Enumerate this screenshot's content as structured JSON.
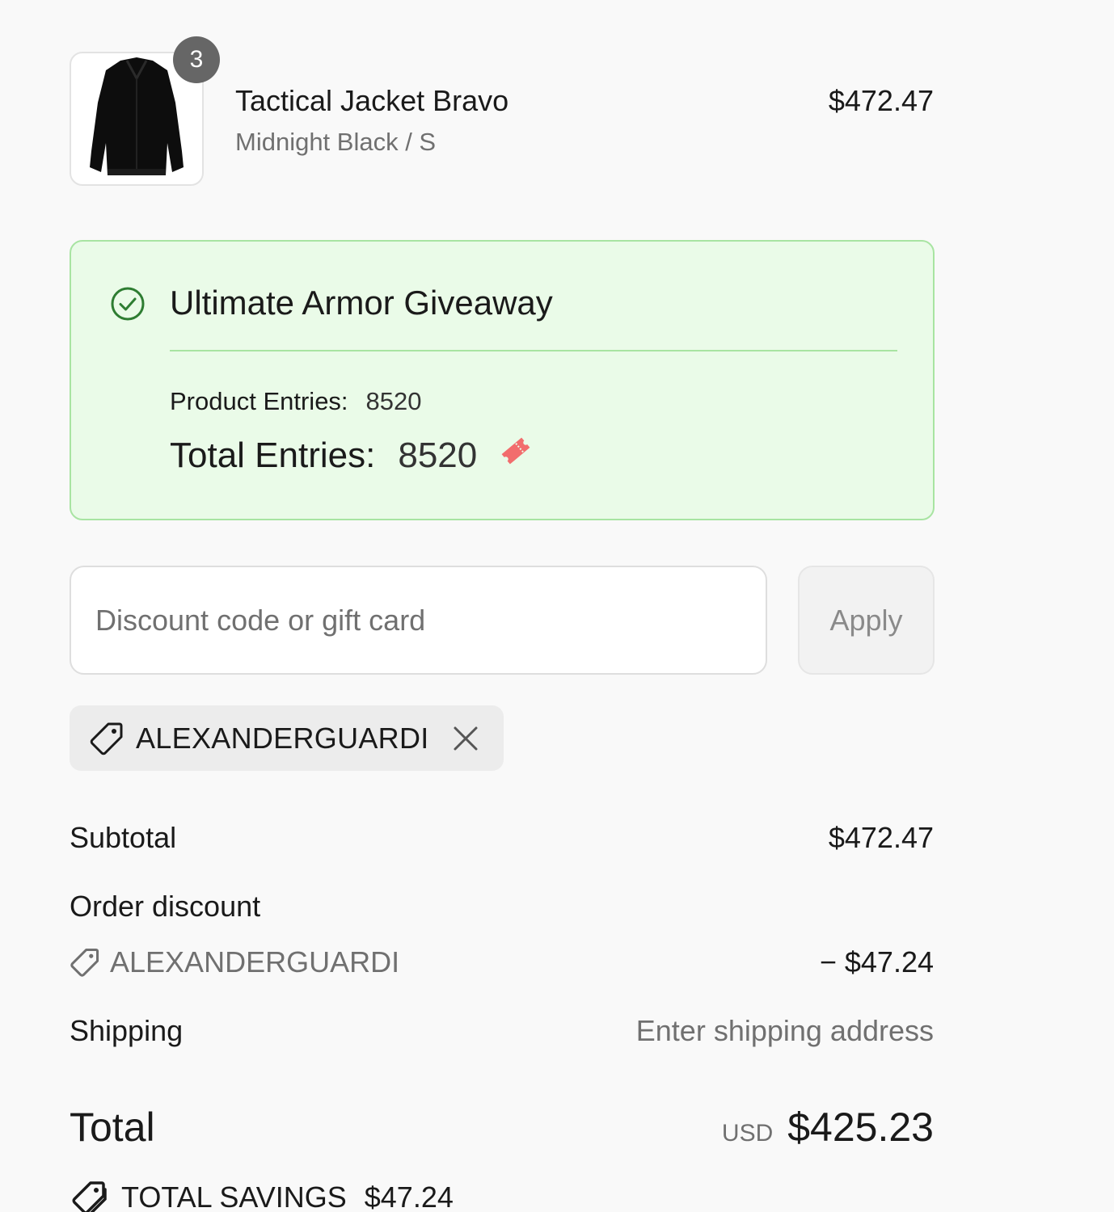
{
  "product": {
    "quantity": "3",
    "name": "Tactical Jacket Bravo",
    "variant": "Midnight Black / S",
    "price": "$472.47",
    "image_icon": "jacket-image"
  },
  "giveaway": {
    "title": "Ultimate Armor Giveaway",
    "product_entries_label": "Product Entries:",
    "product_entries_value": "8520",
    "total_entries_label": "Total Entries:",
    "total_entries_value": "8520",
    "status_icon": "check-circle-icon",
    "entries_icon": "ticket-icon",
    "colors": {
      "background": "#eafbe8",
      "border": "#a8e4a2",
      "check": "#2e7d32",
      "ticket": "#f26d6d"
    }
  },
  "discount": {
    "placeholder": "Discount code or gift card",
    "value": "",
    "apply_label": "Apply",
    "applied_code": "ALEXANDERGUARDI"
  },
  "summary": {
    "subtotal_label": "Subtotal",
    "subtotal_value": "$472.47",
    "order_discount_label": "Order discount",
    "order_discount_code": "ALEXANDERGUARDI",
    "order_discount_value": "− $47.24",
    "shipping_label": "Shipping",
    "shipping_value": "Enter shipping address",
    "total_label": "Total",
    "currency": "USD",
    "total_value": "$425.23",
    "savings_label": "TOTAL SAVINGS",
    "savings_value": "$47.24"
  }
}
